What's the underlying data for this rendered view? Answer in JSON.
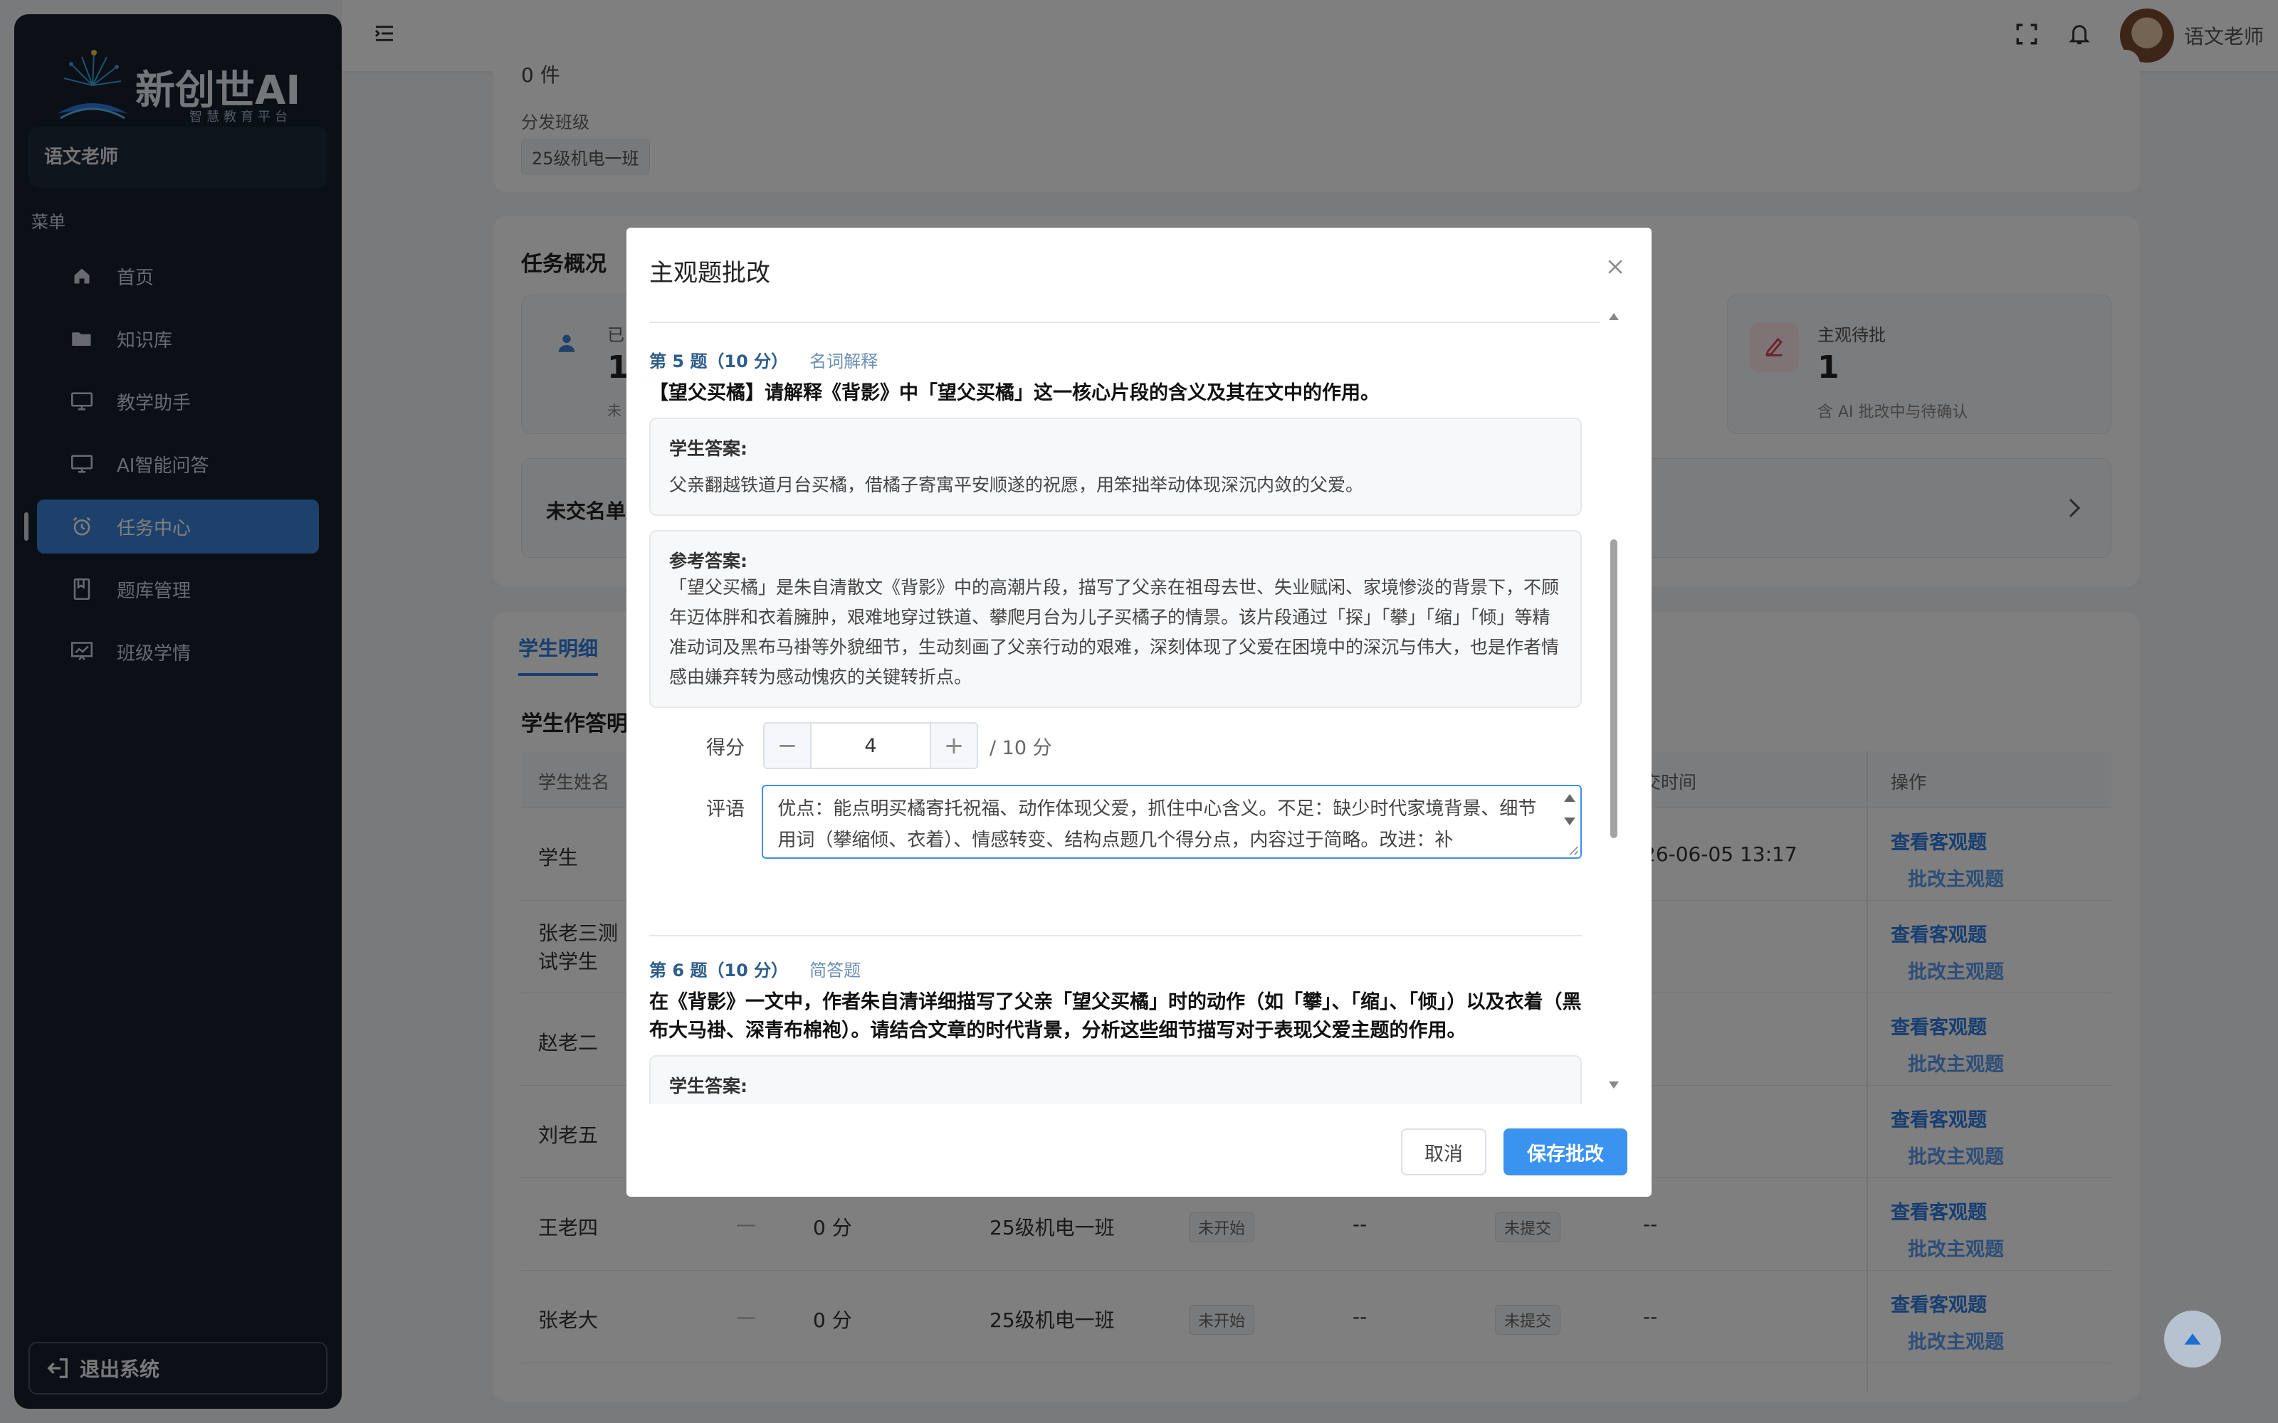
{
  "app": {
    "logo_text": "新创世AI",
    "logo_subtitle": "智慧教育平台",
    "user_card": "语文老师",
    "menu_heading": "菜单",
    "logout_label": "退出系统",
    "active_color": "#3b82d4"
  },
  "sidebar": {
    "items": [
      {
        "label": "首页",
        "icon": "home-icon"
      },
      {
        "label": "知识库",
        "icon": "folder-icon"
      },
      {
        "label": "教学助手",
        "icon": "monitor-icon"
      },
      {
        "label": "AI智能问答",
        "icon": "monitor-icon"
      },
      {
        "label": "任务中心",
        "icon": "alarm-clock-icon",
        "active": true
      },
      {
        "label": "题库管理",
        "icon": "book-icon"
      },
      {
        "label": "班级学情",
        "icon": "chart-board-icon"
      }
    ]
  },
  "header": {
    "user_name": "语文老师"
  },
  "background_page": {
    "count_partial": "0 件",
    "dist_class_label": "分发班级",
    "dist_class_tag": "25级机电一班",
    "overview_title": "任务概况",
    "stat_left_label": "已",
    "stat_left_value": "1",
    "stat_left_note": "未",
    "stat_right_label": "主观待批",
    "stat_right_value": "1",
    "stat_right_note": "含 AI 批改中与待确认",
    "unsubmitted_label": "未交名单",
    "tab_students": "学生明细",
    "table_title": "学生作答明",
    "col_name": "学生姓名",
    "col_time": "交时间",
    "col_ops": "操作",
    "rows": [
      {
        "name": "学生",
        "time": "26-06-05 13:17",
        "op1": "查看客观题",
        "op2": "批改主观题"
      },
      {
        "name": "张老三测试学生",
        "op1": "查看客观题",
        "op2": "批改主观题"
      },
      {
        "name": "赵老二",
        "op1": "查看客观题",
        "op2": "批改主观题"
      },
      {
        "name": "刘老五",
        "op1": "查看客观题",
        "op2": "批改主观题"
      },
      {
        "name": "王老四",
        "dash": "—",
        "score": "0 分",
        "class": "25级机电一班",
        "status": "未开始",
        "ans": "--",
        "submit": "未提交",
        "time": "--",
        "op1": "查看客观题",
        "op2": "批改主观题"
      },
      {
        "name": "张老大",
        "dash": "—",
        "score": "0 分",
        "class": "25级机电一班",
        "status": "未开始",
        "ans": "--",
        "submit": "未提交",
        "time": "--",
        "op1": "查看客观题",
        "op2": "批改主观题"
      }
    ]
  },
  "modal": {
    "title": "主观题批改",
    "q5": {
      "head": "第 5 题（10 分）",
      "type": "名词解释",
      "text": "【望父买橘】请解释《背影》中「望父买橘」这一核心片段的含义及其在文中的作用。",
      "student_label": "学生答案:",
      "student_answer": "父亲翻越铁道月台买橘，借橘子寄寓平安顺遂的祝愿，用笨拙举动体现深沉内敛的父爱。",
      "ref_label": "参考答案:",
      "ref_answer": "「望父买橘」是朱自清散文《背影》中的高潮片段，描写了父亲在祖母去世、失业赋闲、家境惨淡的背景下，不顾年迈体胖和衣着臃肿，艰难地穿过铁道、攀爬月台为儿子买橘子的情景。该片段通过「探」「攀」「缩」「倾」等精准动词及黑布马褂等外貌细节，生动刻画了父亲行动的艰难，深刻体现了父爱在困境中的深沉与伟大，也是作者情感由嫌弃转为感动愧疚的关键转折点。",
      "score_label": "得分",
      "score_value": "4",
      "score_total": "/ 10 分",
      "comment_label": "评语",
      "comment_text": "优点：能点明买橘寄托祝福、动作体现父爱，抓住中心含义。不足：缺少时代家境背景、细节用词（攀缩倾、衣着）、情感转变、结构点题几个得分点，内容过于简略。改进：补"
    },
    "q6": {
      "head": "第 6 题（10 分）",
      "type": "简答题",
      "text": "在《背影》一文中，作者朱自清详细描写了父亲「望父买橘」时的动作（如「攀」、「缩」、「倾」）以及衣着（黑布大马褂、深青布棉袍）。请结合文章的时代背景，分析这些细节描写对于表现父爱主题的作用。",
      "student_label": "学生答案:"
    },
    "cancel_label": "取消",
    "save_label": "保存批改",
    "primary_color": "#3b93f0"
  }
}
